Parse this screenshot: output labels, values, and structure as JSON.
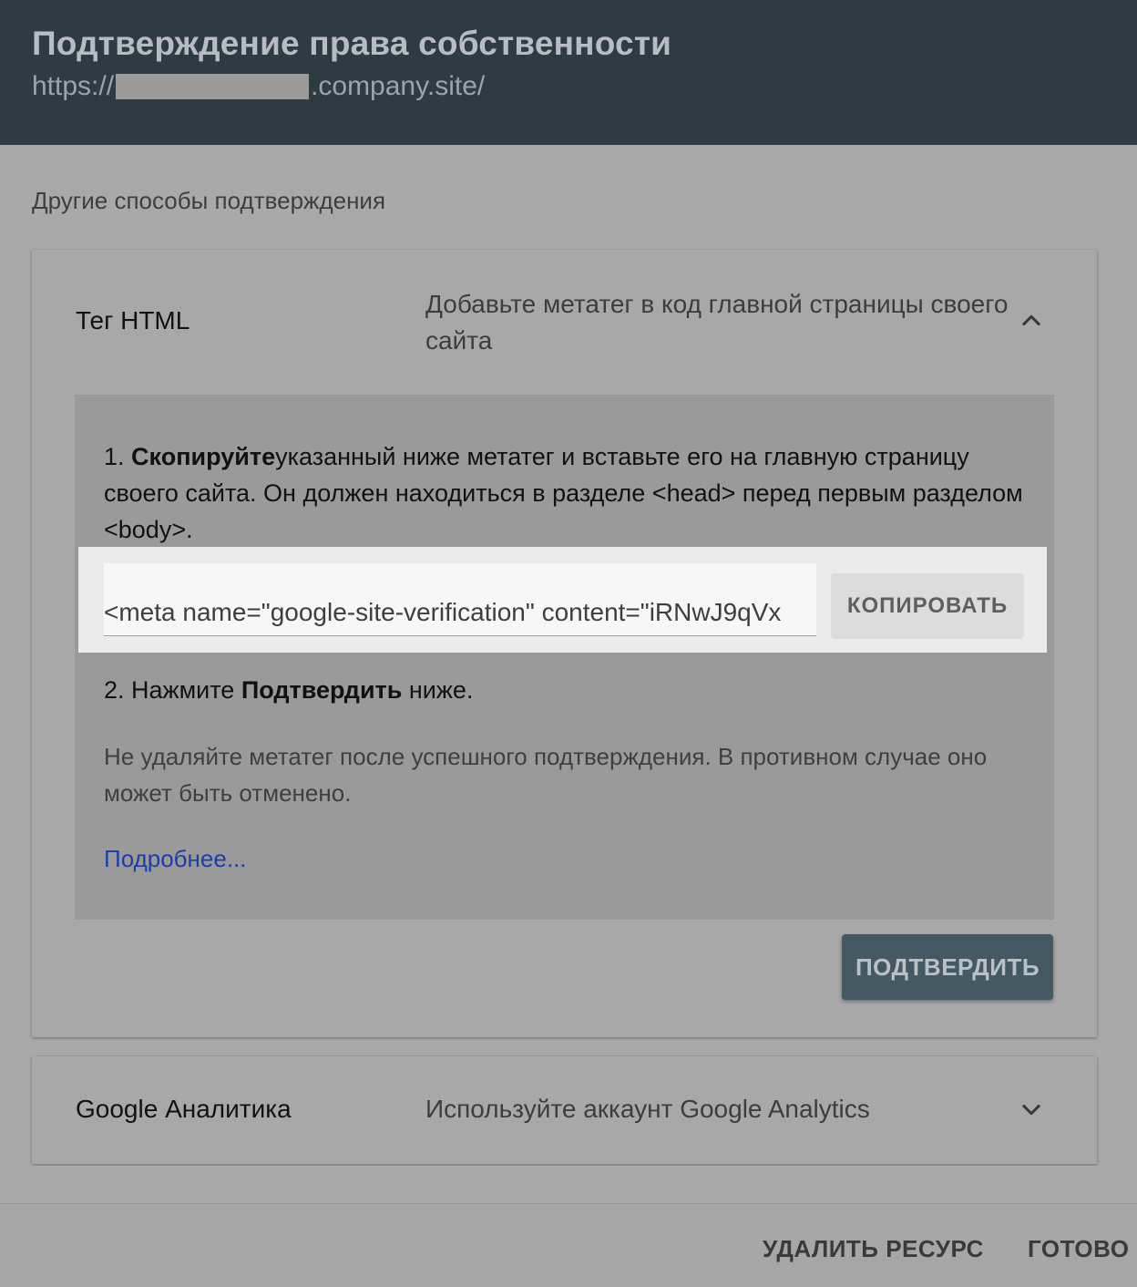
{
  "header": {
    "title": "Подтверждение права собственности",
    "url_prefix": "https://",
    "url_suffix": ".company.site/"
  },
  "section_label": "Другие способы подтверждения",
  "methods": [
    {
      "name": "Тег HTML",
      "description": "Добавьте метатег в код главной страницы своего сайта",
      "expanded": true,
      "icon": "chevron-up-icon",
      "step1": {
        "number": "1.",
        "bold": "Скопируйте",
        "text": "указанный ниже метатег и вставьте его на главную страницу своего сайта. Он должен находиться в разделе <head> перед первым разделом <body>."
      },
      "meta_tag_value": "<meta name=\"google-site-verification\" content=\"iRNwJ9qVx",
      "copy_label": "КОПИРОВАТЬ",
      "step2": {
        "prefix": "2. Нажмите ",
        "bold": "Подтвердить",
        "suffix": " ниже."
      },
      "note": "Не удаляйте метатег после успешного подтверждения. В противном случае оно может быть отменено.",
      "more_link": "Подробнее...",
      "confirm_label": "ПОДТВЕРДИТЬ"
    },
    {
      "name": "Google Аналитика",
      "description": "Используйте аккаунт Google Analytics",
      "expanded": false,
      "icon": "chevron-down-icon"
    }
  ],
  "footer": {
    "delete_label": "УДАЛИТЬ РЕСУРС",
    "done_label": "ГОТОВО"
  },
  "colors": {
    "header_bg": "#2e3b43",
    "confirm_bg": "#455963",
    "link": "#1a3fa8"
  }
}
